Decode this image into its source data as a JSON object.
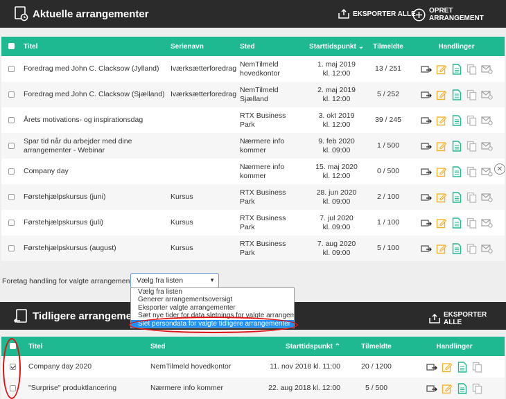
{
  "current": {
    "title": "Aktuelle arrangementer",
    "export_label": "EKSPORTER ALLE",
    "create_label": "OPRET ARRANGEMENT",
    "columns": {
      "title": "Titel",
      "series": "Serienavn",
      "place": "Sted",
      "start": "Starttidspunkt",
      "signed": "Tilmeldte",
      "actions": "Handlinger"
    },
    "rows": [
      {
        "title": "Foredrag med John C. Clacksow (Jylland)",
        "series": "Iværksætterforedrag",
        "place": "NemTilmeld hovedkontor",
        "date": "1. maj 2019",
        "time": "kl. 12:00",
        "signed": "13 / 251"
      },
      {
        "title": "Foredrag med John C. Clacksow (Sjælland)",
        "series": "Iværksætterforedrag",
        "place": "NemTilmeld Sjælland",
        "date": "2. maj 2019",
        "time": "kl. 12:00",
        "signed": "5 / 252"
      },
      {
        "title": "Årets motivations- og inspirationsdag",
        "series": "",
        "place": "RTX Business Park",
        "date": "3. okt 2019",
        "time": "kl. 12:00",
        "signed": "39 / 245"
      },
      {
        "title": "Spar tid når du arbejder med dine arrangementer - Webinar",
        "series": "",
        "place": "Nærmere info kommer",
        "date": "9. feb 2020",
        "time": "kl. 09:00",
        "signed": "1 / 500"
      },
      {
        "title": "Company day",
        "series": "",
        "place": "Nærmere info kommer",
        "date": "15. maj 2020",
        "time": "kl. 12:00",
        "signed": "0 / 500"
      },
      {
        "title": "Førstehjælpskursus (juni)",
        "series": "Kursus",
        "place": "RTX Business Park",
        "date": "28. jun 2020",
        "time": "kl. 09:00",
        "signed": "2 / 100"
      },
      {
        "title": "Førstehjælpskursus (juli)",
        "series": "Kursus",
        "place": "RTX Business Park",
        "date": "7. jul 2020",
        "time": "kl. 09:00",
        "signed": "1 / 100"
      },
      {
        "title": "Førstehjælpskursus (august)",
        "series": "Kursus",
        "place": "RTX Business Park",
        "date": "7. aug 2020",
        "time": "kl. 09:00",
        "signed": "5 / 100"
      }
    ]
  },
  "bulk": {
    "label": "Foretag handling for valgte arrangementer:",
    "selected": "Vælg fra listen",
    "options": [
      "Vælg fra listen",
      "Generer arrangementsoversigt",
      "Eksporter valgte arrangementer",
      "Sæt nye tider for data sletnings for valgte arrangementer",
      "Slet persondata for valgte tidligere arrangementer"
    ]
  },
  "previous": {
    "title": "Tidligere arrangementer",
    "export_label": "EKSPORTER ALLE",
    "columns": {
      "title": "Titel",
      "place": "Sted",
      "start": "Starttidspunkt",
      "signed": "Tilmeldte",
      "actions": "Handlinger"
    },
    "rows": [
      {
        "title": "Company day 2020",
        "place": "NemTilmeld hovedkontor",
        "start": "11. nov 2018 kl. 11:00",
        "signed": "20 / 1200",
        "checked": true
      },
      {
        "title": "\"Surprise\" produktlancering",
        "place": "Nærmere info kommer",
        "start": "22. aug 2018 kl. 12:00",
        "signed": "5 / 500",
        "checked": false
      }
    ]
  },
  "colors": {
    "header_bg": "#2b2b2b",
    "table_header": "#1eb891",
    "highlight": "#e01010",
    "selected_option": "#1e90ff"
  }
}
